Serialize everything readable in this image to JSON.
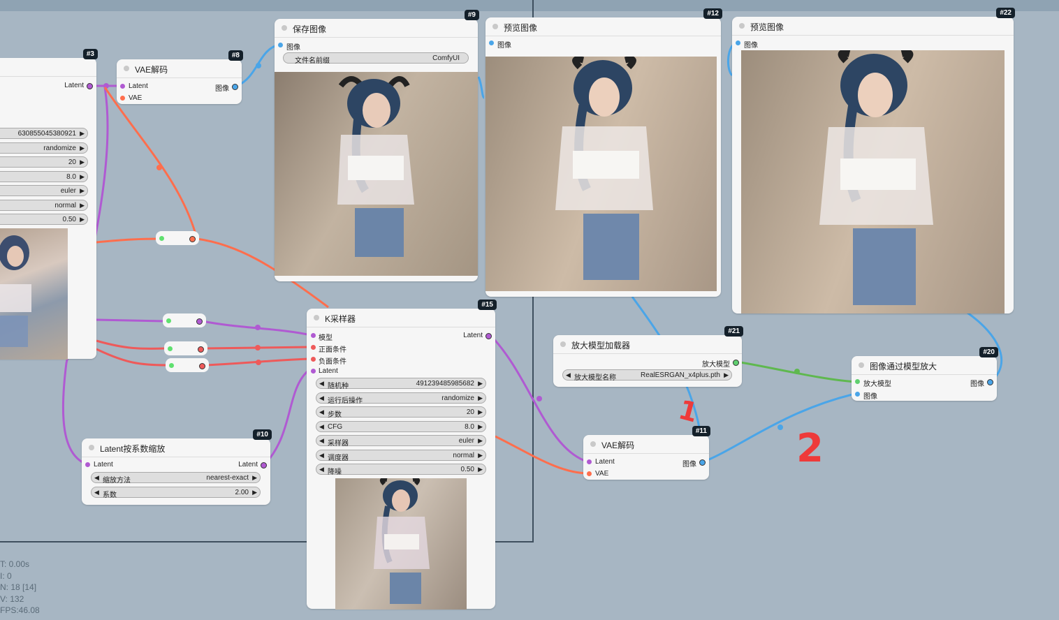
{
  "nodes": {
    "ksampler_left": {
      "badge": "#3",
      "latent_out": "Latent",
      "widget_values": [
        "630855045380921",
        "randomize",
        "20",
        "8.0",
        "euler",
        "normal",
        "0.50"
      ]
    },
    "vae_decode_8": {
      "badge": "#8",
      "title": "VAE解码",
      "in_latent": "Latent",
      "in_vae": "VAE",
      "out_image": "图像"
    },
    "save_image_9": {
      "badge": "#9",
      "title": "保存图像",
      "in_image": "图像",
      "prefix_label": "文件名前缀",
      "prefix_value": "ComfyUI"
    },
    "preview_12": {
      "badge": "#12",
      "title": "预览图像",
      "in_image": "图像"
    },
    "preview_22": {
      "badge": "#22",
      "title": "预览图像",
      "in_image": "图像"
    },
    "ksampler_15": {
      "badge": "#15",
      "title": "K采样器",
      "in_model": "模型",
      "in_positive": "正面条件",
      "in_negative": "负面条件",
      "in_latent": "Latent",
      "out_latent": "Latent",
      "widgets": [
        {
          "label": "随机种",
          "value": "491239485985682"
        },
        {
          "label": "运行后操作",
          "value": "randomize"
        },
        {
          "label": "步数",
          "value": "20"
        },
        {
          "label": "CFG",
          "value": "8.0"
        },
        {
          "label": "采样器",
          "value": "euler"
        },
        {
          "label": "调度器",
          "value": "normal"
        },
        {
          "label": "降噪",
          "value": "0.50"
        }
      ]
    },
    "upscale_loader_21": {
      "badge": "#21",
      "title": "放大模型加载器",
      "out_model": "放大模型",
      "widget_label": "放大模型名称",
      "widget_value": "RealESRGAN_x4plus.pth"
    },
    "upscale_with_model_20": {
      "badge": "#20",
      "title": "图像通过模型放大",
      "in_model": "放大模型",
      "in_image": "图像",
      "out_image": "图像"
    },
    "vae_decode_11": {
      "badge": "#11",
      "title": "VAE解码",
      "in_latent": "Latent",
      "in_vae": "VAE",
      "out_image": "图像"
    },
    "latent_scale_10": {
      "badge": "#10",
      "title": "Latent按系数缩放",
      "in_latent": "Latent",
      "out_latent": "Latent",
      "widgets": [
        {
          "label": "缩放方法",
          "value": "nearest-exact"
        },
        {
          "label": "系数",
          "value": "2.00"
        }
      ]
    }
  },
  "stats": [
    "T: 0.00s",
    "I: 0",
    "N: 18 [14]",
    "V: 132",
    "FPS:46.08"
  ],
  "annotations": [
    "1",
    "2"
  ],
  "colors": {
    "background": "#a7b6c3",
    "model": "#b05ad2",
    "image": "#4aa5e8",
    "latent": "#ff9bd4",
    "vae": "#ff6e4d",
    "conditioning": "#ee5a5a",
    "upscale_model": "#5fcf6f"
  }
}
